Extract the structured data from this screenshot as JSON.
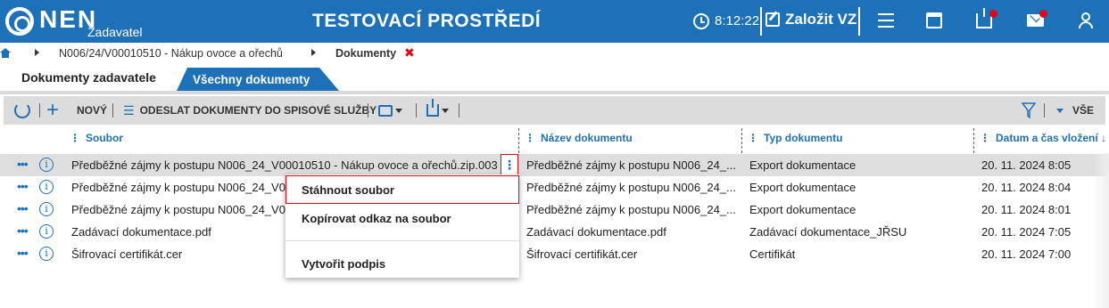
{
  "header": {
    "brand": "NEN",
    "brand_sub": "Zadavatel",
    "environment": "TESTOVACÍ PROSTŘEDÍ",
    "time": "8:12:22",
    "create_vz": "Založit VZ",
    "icons": [
      "clock-icon",
      "edit-icon",
      "menu-icon",
      "calendar-icon",
      "inbox-icon",
      "mail-icon",
      "user-icon"
    ],
    "notification_color": "#e30613",
    "brand_color": "#1d71b8"
  },
  "breadcrumb": {
    "items": [
      "N006/24/V00010510 - Nákup ovoce a ořechů",
      "Dokumenty"
    ],
    "close": "✖"
  },
  "tabs": [
    {
      "label": "Dokumenty zadavatele",
      "active": true
    },
    {
      "label": "Všechny dokumenty",
      "active": false
    }
  ],
  "toolbar": {
    "new_label": "NOVÝ",
    "send_label": "ODESLAT DOKUMENTY DO SPISOVÉ SLUŽBY",
    "filter_scope": "VŠE"
  },
  "table": {
    "columns": [
      "Soubor",
      "Název dokumentu",
      "Typ dokumentu",
      "Datum a čas vložení ↓"
    ],
    "rows": [
      {
        "file": "Předběžné zájmy k postupu N006_24_V00010510 - Nákup ovoce a ořechů.zip.003",
        "name": "Předběžné zájmy k postupu N006_24_...",
        "type": "Export dokumentace",
        "date": "20. 11. 2024 8:05"
      },
      {
        "file": "Předběžné zájmy k postupu N006_24_V0",
        "name": "Předběžné zájmy k postupu N006_24_...",
        "type": "Export dokumentace",
        "date": "20. 11. 2024 8:04"
      },
      {
        "file": "Předběžné zájmy k postupu N006_24_V0",
        "name": "Předběžné zájmy k postupu N006_24_...",
        "type": "Export dokumentace",
        "date": "20. 11. 2024 8:01"
      },
      {
        "file": "Zadávací dokumentace.pdf",
        "name": "Zadávací dokumentace.pdf",
        "type": "Zadávací dokumentace_JŘSU",
        "date": "20. 11. 2024 7:05"
      },
      {
        "file": "Šifrovací certifikát.cer",
        "name": "Šifrovací certifikát.cer",
        "type": "Certifikát",
        "date": "20. 11. 2024 7:00"
      }
    ]
  },
  "context_menu": {
    "items": [
      "Stáhnout soubor",
      "Kopírovat odkaz na soubor",
      "Vytvořit podpis"
    ]
  }
}
